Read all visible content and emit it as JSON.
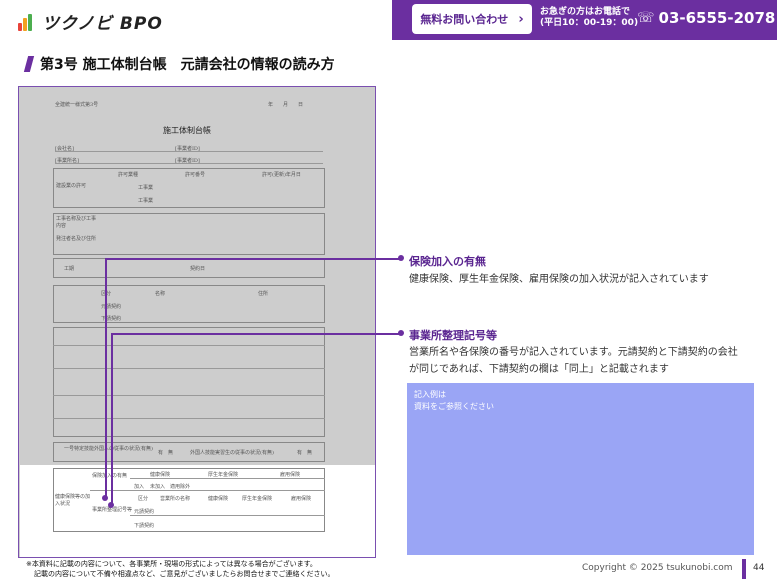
{
  "header": {
    "logo_text": "ツクノビ BPO",
    "contact_button_label": "無料お問い合わせ",
    "urgent_line1": "お急ぎの方はお電話で",
    "urgent_line2": "(平日10：00-19：00)",
    "phone_number": "03-6555-2078"
  },
  "page_title": "第3号 施工体制台帳　元請会社の情報の読み方",
  "form": {
    "top_left": "全建統一様式第3号",
    "date_label": "年　　月　　日",
    "title": "施工体制台帳",
    "company_label": "[会社名]",
    "office_label": "[事業所名]",
    "business_label": "[事業者ID]",
    "business_label2": "[事業者ID]",
    "license_label": "建設業の許可",
    "permit_type": "許可業種",
    "permit_number": "許可番号",
    "permit_date": "許可(更新)年月日",
    "construction_label": "工事業",
    "construction_name": "工事名称及び工事内容",
    "client_label": "発注者名及び住所",
    "period_label": "工期",
    "contract_date": "契約日",
    "section_label": "区分",
    "name_label": "名称",
    "address_label": "住所",
    "contract_prime": "元請契約",
    "contract_sub": "下請契約",
    "insurance_label": "健康保険等の加入状況",
    "insurance_status": "保険加入の有無",
    "office_number": "事業所整理記号等",
    "health_ins": "健康保険",
    "pension_ins": "厚生年金保険",
    "employment_ins": "雇用保険",
    "joined": "加入",
    "not_joined": "未加入",
    "exempt": "適用除外",
    "office_name_col": "営業所の名称",
    "foreign_label": "外国人技能実習生の従事の状況(有無)",
    "specific_label": "一号特定技能外国人の従事の状況(有無)",
    "yes_no": "有　無",
    "yes_no2": "有　無"
  },
  "annotations": [
    {
      "title": "保険加入の有無",
      "body": "健康保険、厚生年金保険、雇用保険の加入状況が記入されています"
    },
    {
      "title": "事業所整理記号等",
      "body": "営業所名や各保険の番号が記入されています。元請契約と下請契約の会社が同じであれば、下請契約の欄は「同上」と記載されます"
    }
  ],
  "sample": {
    "line1": "記入例は",
    "line2": "資料をご参照ください"
  },
  "footnote": {
    "line1": "※本資料に記載の内容について、各事業所・現場の形式によっては異なる場合がございます。",
    "line2": "記載の内容について不備や相違点など、ご意見がございましたらお問合せまでご連絡ください。"
  },
  "copyright": "Copyright © 2025 tsukunobi.com",
  "page_number": "44",
  "colors": {
    "brand_purple": "#6b2fa0",
    "sample_box": "#9aa5f5"
  }
}
